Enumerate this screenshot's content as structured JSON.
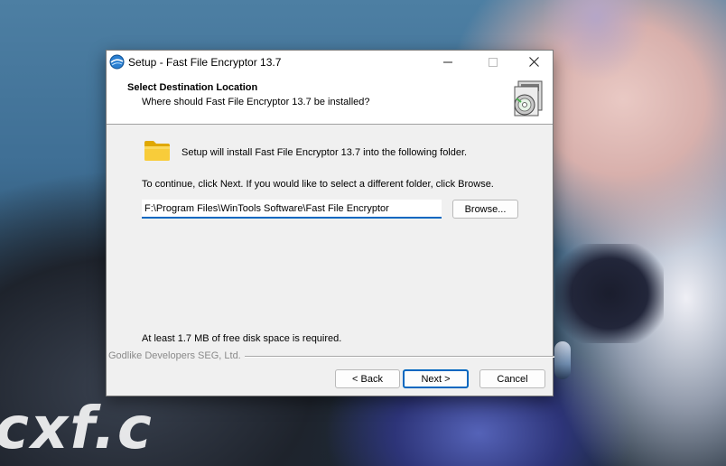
{
  "watermark": "cxf.c",
  "window": {
    "title": "Setup - Fast File Encryptor 13.7",
    "minimize_glyph": "—",
    "maximize_glyph": "☐",
    "close_glyph": "✕"
  },
  "header": {
    "title": "Select Destination Location",
    "subtitle": "Where should Fast File Encryptor 13.7 be installed?",
    "icon": "setup-disc-icon"
  },
  "body": {
    "install_text": "Setup will install Fast File Encryptor 13.7 into the following folder.",
    "continue_text": "To continue, click Next. If you would like to select a different folder, click Browse.",
    "path_value": "F:\\Program Files\\WinTools Software\\Fast File Encryptor",
    "browse_label": "Browse...",
    "space_text": "At least 1.7 MB of free disk space is required.",
    "folder_icon": "folder-icon"
  },
  "footer": {
    "brand": "Godlike Developers SEG, Ltd.",
    "back_label": "< Back",
    "next_label": "Next >",
    "cancel_label": "Cancel"
  },
  "colors": {
    "accent": "#0067c0",
    "dialog_bg": "#f0f0f0",
    "folder": "#f5c518"
  }
}
